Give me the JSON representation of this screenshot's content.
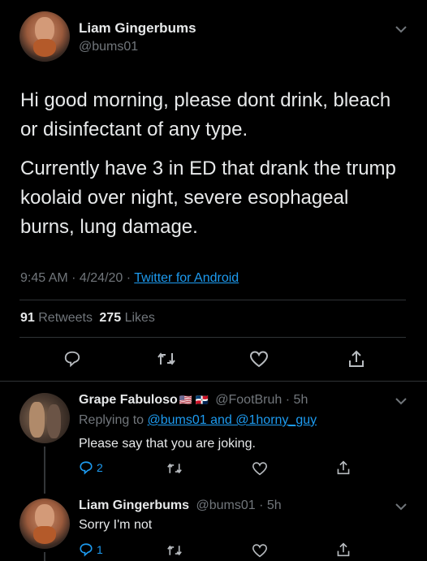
{
  "main_tweet": {
    "author_name": "Liam Gingerbums",
    "author_handle": "@bums01",
    "paragraph1": "Hi good morning, please dont drink, bleach or disinfectant of any type.",
    "paragraph2": "Currently have 3 in ED that drank the trump koolaid over night, severe esophageal burns, lung damage.",
    "time": "9:45 AM",
    "separator": " · ",
    "date": "4/24/20",
    "source": "Twitter for Android",
    "retweets_count": "91",
    "retweets_label": "Retweets",
    "likes_count": "275",
    "likes_label": "Likes"
  },
  "replies": [
    {
      "author_name": "Grape Fabuloso",
      "flags": "🇺🇸 🇩🇴",
      "author_handle": "@FootBruh",
      "time": "· 5h",
      "replying_to_label": "Replying to",
      "replying_to_users": "@bums01 and @1horny_guy",
      "text": "Please say that you are joking.",
      "reply_count": "2"
    },
    {
      "author_name": "Liam Gingerbums",
      "author_handle": "@bums01",
      "time": "· 5h",
      "text": "Sorry I'm not",
      "reply_count": "1"
    }
  ],
  "colors": {
    "background": "#000000",
    "text": "#e7e9ea",
    "muted": "#71767b",
    "link": "#1d9bf0",
    "divider": "#2f3336"
  },
  "icons": [
    "chevron-down-icon",
    "reply-icon",
    "retweet-icon",
    "like-icon",
    "share-icon",
    "flag-us-icon",
    "flag-dr-icon"
  ]
}
